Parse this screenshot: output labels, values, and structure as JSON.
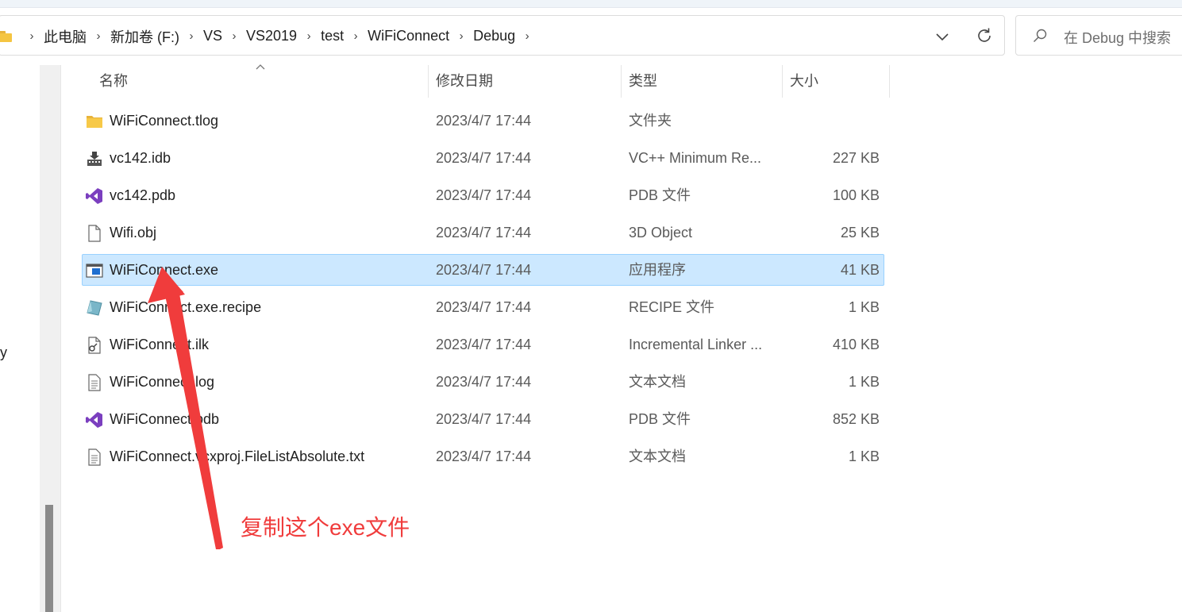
{
  "breadcrumb": {
    "items": [
      "此电脑",
      "新加卷 (F:)",
      "VS",
      "VS2019",
      "test",
      "WiFiConnect",
      "Debug"
    ]
  },
  "search": {
    "placeholder": "在 Debug 中搜索"
  },
  "nav": {
    "clipped_text": "y"
  },
  "columns": {
    "name": "名称",
    "date": "修改日期",
    "type": "类型",
    "size": "大小"
  },
  "files": [
    {
      "name": "WiFiConnect.tlog",
      "date": "2023/4/7 17:44",
      "type": "文件夹",
      "size": "",
      "icon": "folder-icon"
    },
    {
      "name": "vc142.idb",
      "date": "2023/4/7 17:44",
      "type": "VC++ Minimum Re...",
      "size": "227 KB",
      "icon": "idb-file-icon"
    },
    {
      "name": "vc142.pdb",
      "date": "2023/4/7 17:44",
      "type": "PDB 文件",
      "size": "100 KB",
      "icon": "visual-studio-icon"
    },
    {
      "name": "Wifi.obj",
      "date": "2023/4/7 17:44",
      "type": "3D Object",
      "size": "25 KB",
      "icon": "blank-file-icon"
    },
    {
      "name": "WiFiConnect.exe",
      "date": "2023/4/7 17:44",
      "type": "应用程序",
      "size": "41 KB",
      "icon": "exe-app-icon",
      "selected": true
    },
    {
      "name": "WiFiConnect.exe.recipe",
      "date": "2023/4/7 17:44",
      "type": "RECIPE 文件",
      "size": "1 KB",
      "icon": "recipe-file-icon"
    },
    {
      "name": "WiFiConnect.ilk",
      "date": "2023/4/7 17:44",
      "type": "Incremental Linker ...",
      "size": "410 KB",
      "icon": "ilk-file-icon"
    },
    {
      "name": "WiFiConnect.log",
      "date": "2023/4/7 17:44",
      "type": "文本文档",
      "size": "1 KB",
      "icon": "text-file-icon"
    },
    {
      "name": "WiFiConnect.pdb",
      "date": "2023/4/7 17:44",
      "type": "PDB 文件",
      "size": "852 KB",
      "icon": "visual-studio-icon"
    },
    {
      "name": "WiFiConnect.vcxproj.FileListAbsolute.txt",
      "date": "2023/4/7 17:44",
      "type": "文本文档",
      "size": "1 KB",
      "icon": "text-file-icon"
    }
  ],
  "annotation": {
    "text": "复制这个exe文件",
    "color": "#f03c3c"
  },
  "colors": {
    "selection": "#cce8ff",
    "selection_border": "#99d1ff",
    "folder": "#f5c541",
    "vs_purple": "#7b3fbf"
  }
}
